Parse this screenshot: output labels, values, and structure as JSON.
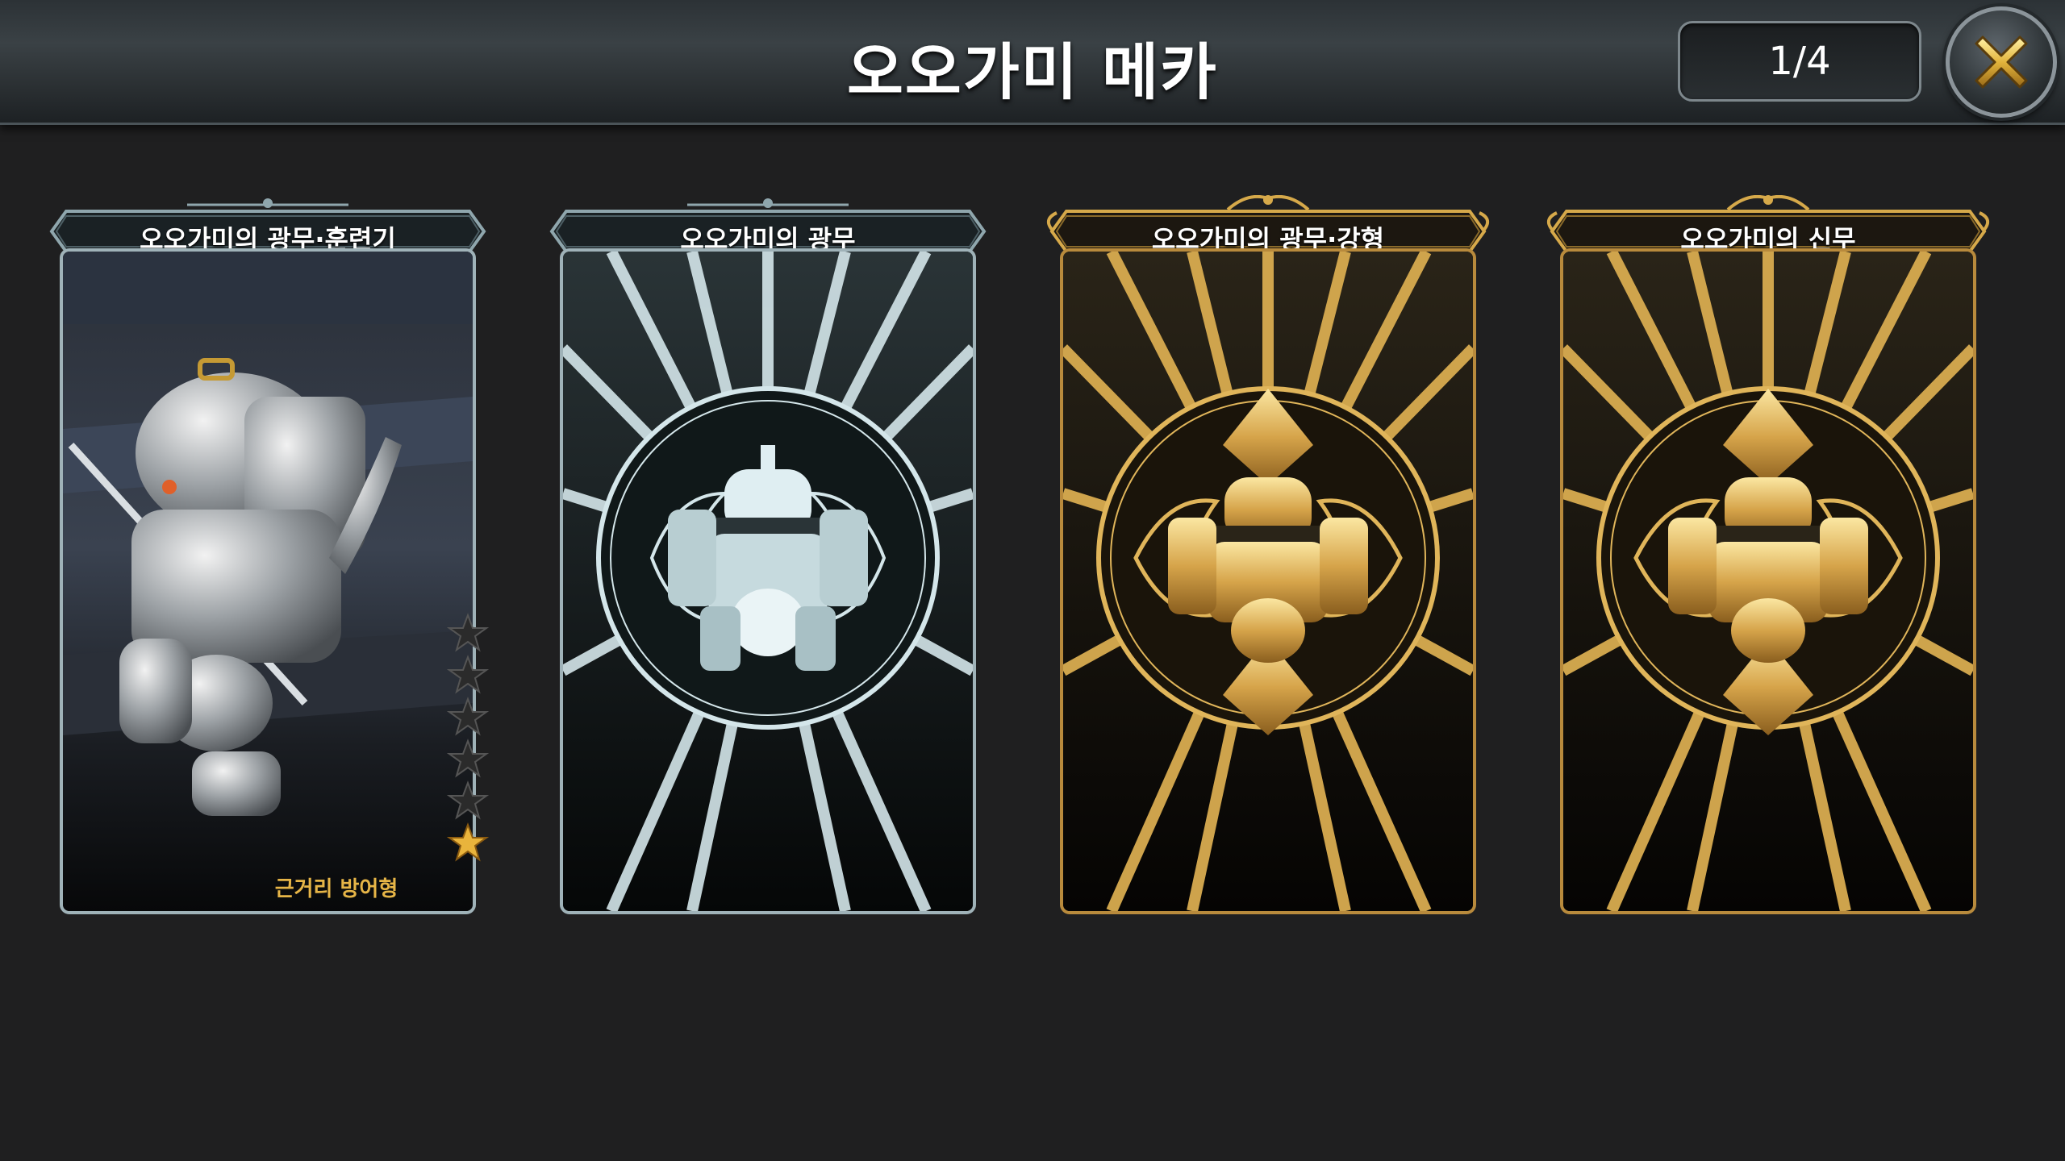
{
  "header": {
    "title": "오오가미 메카",
    "page_counter": "1/4"
  },
  "cards": [
    {
      "name": "오오가미의 광무·훈련기",
      "role": "근거리 방어형",
      "stars_total": 6,
      "stars_filled": 1,
      "tier": "silver",
      "revealed": true
    },
    {
      "name": "오오가미의 광무",
      "tier": "silver",
      "revealed": false
    },
    {
      "name": "오오가미의 광무·강형",
      "tier": "gold",
      "revealed": false
    },
    {
      "name": "오오가미의 신무",
      "tier": "gold",
      "revealed": false
    }
  ],
  "colors": {
    "background": "#1f1f20",
    "silver": "#9fb2b8",
    "gold": "#d6a94a",
    "role_text": "#e6b547"
  },
  "icons": {
    "close": "close-x-icon",
    "star": "star-icon"
  }
}
